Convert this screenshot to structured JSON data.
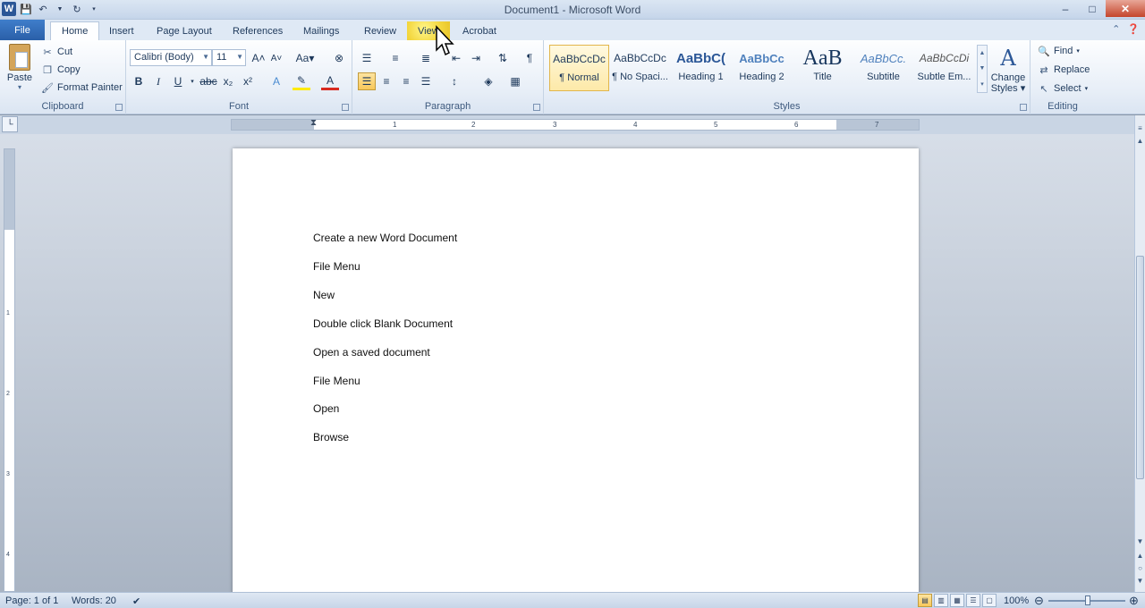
{
  "window": {
    "title": "Document1 - Microsoft Word",
    "app_letter": "W"
  },
  "tabs": [
    {
      "label": "File"
    },
    {
      "label": "Home"
    },
    {
      "label": "Insert"
    },
    {
      "label": "Page Layout"
    },
    {
      "label": "References"
    },
    {
      "label": "Mailings"
    },
    {
      "label": "Review"
    },
    {
      "label": "View"
    },
    {
      "label": "Acrobat"
    }
  ],
  "clipboard": {
    "group_label": "Clipboard",
    "paste": "Paste",
    "cut": "Cut",
    "copy": "Copy",
    "format_painter": "Format Painter"
  },
  "font": {
    "group_label": "Font",
    "family": "Calibri (Body)",
    "size": "11"
  },
  "paragraph": {
    "group_label": "Paragraph"
  },
  "styles": {
    "group_label": "Styles",
    "items": [
      {
        "sample": "AaBbCcDc",
        "name": "¶ Normal"
      },
      {
        "sample": "AaBbCcDc",
        "name": "¶ No Spaci..."
      },
      {
        "sample": "AaBbC(",
        "name": "Heading 1"
      },
      {
        "sample": "AaBbCc",
        "name": "Heading 2"
      },
      {
        "sample": "AaB",
        "name": "Title"
      },
      {
        "sample": "AaBbCc.",
        "name": "Subtitle"
      },
      {
        "sample": "AaBbCcDi",
        "name": "Subtle Em..."
      }
    ],
    "change_styles_line1": "Change",
    "change_styles_line2": "Styles"
  },
  "editing": {
    "group_label": "Editing",
    "find": "Find",
    "replace": "Replace",
    "select": "Select"
  },
  "ruler_numbers": [
    "1",
    "1",
    "2",
    "3",
    "4",
    "5",
    "6",
    "7"
  ],
  "vruler_numbers": [
    "1",
    "2",
    "3",
    "4"
  ],
  "document_lines": [
    "Create a new Word Document",
    "File Menu",
    "New",
    "Double click Blank Document",
    "Open a saved document",
    "File Menu",
    "Open",
    "Browse"
  ],
  "status": {
    "page": "Page: 1 of 1",
    "words": "Words: 20",
    "zoom": "100%"
  },
  "colors": {
    "file_tab": "#2a5fa8",
    "highlight": "#f3d63d",
    "ribbon_bg": "#e7eef7"
  }
}
